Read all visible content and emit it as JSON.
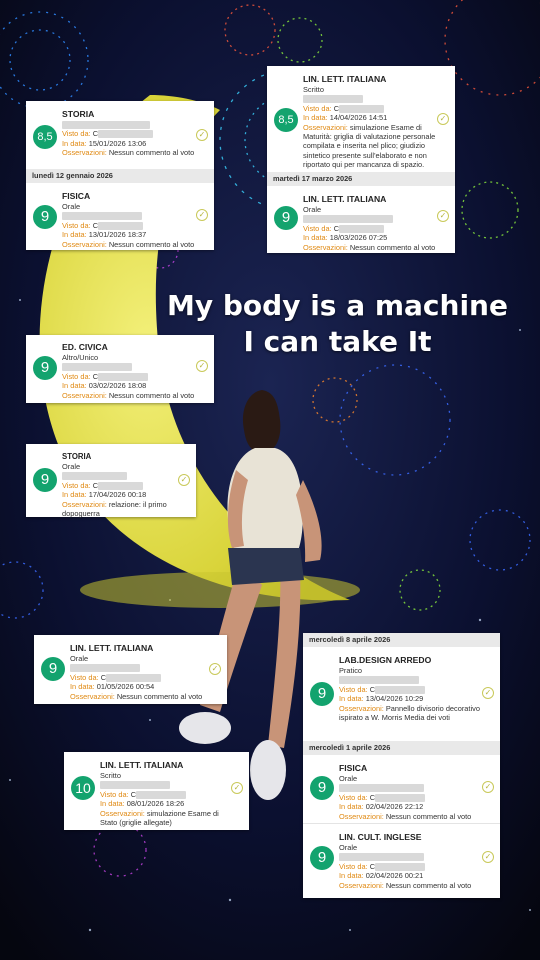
{
  "caption": {
    "line1": "My body is a machine",
    "line2": "I can take It"
  },
  "labels": {
    "visto": "Visto da:",
    "data": "In data:",
    "oss": "Osservazioni:"
  },
  "cards": [
    {
      "name": "storia-fisica",
      "entries": [
        {
          "subject": "STORIA",
          "type": "",
          "grade": "8,5",
          "visto": "C",
          "data": "15/01/2026 13:06",
          "oss": "Nessun commento al voto"
        },
        {
          "separator": "lunedì 12 gennaio 2026",
          "subject": "FISICA",
          "type": "Orale",
          "grade": "9",
          "visto": "C",
          "data": "13/01/2026 18:37",
          "oss": "Nessun commento al voto"
        }
      ]
    },
    {
      "name": "italiano-marzo",
      "entries": [
        {
          "subject": "LIN. LETT. ITALIANA",
          "type": "Scritto",
          "grade": "8,5",
          "visto": "C",
          "data": "14/04/2026 14:51",
          "oss": "simulazione Esame di Maturità: griglia di valutazione personale compilata e inserita nel plico; giudizio sintetico presente sull'elaborato e non riportato qui per mancanza di spazio."
        },
        {
          "separator": "martedì 17 marzo 2026",
          "subject": "LIN. LETT. ITALIANA",
          "type": "Orale",
          "grade": "9",
          "visto": "C",
          "data": "18/03/2026 07:25",
          "oss": "Nessun commento al voto"
        }
      ]
    },
    {
      "name": "ed-civica",
      "entries": [
        {
          "subject": "ED. CIVICA",
          "type": "Altro/Unico",
          "grade": "9",
          "visto": "C",
          "data": "03/02/2026 18:08",
          "oss": "Nessun commento al voto"
        }
      ]
    },
    {
      "name": "storia-orale",
      "entries": [
        {
          "subject": "STORIA",
          "type": "Orale",
          "grade": "9",
          "visto": "C",
          "data": "17/04/2026 00:18",
          "oss": "relazione: il primo dopoguerra"
        }
      ]
    },
    {
      "name": "italiano-orale",
      "entries": [
        {
          "subject": "LIN. LETT. ITALIANA",
          "type": "Orale",
          "grade": "9",
          "visto": "C",
          "data": "01/05/2026 00:54",
          "oss": "Nessun commento al voto"
        }
      ]
    },
    {
      "name": "italiano-scritto",
      "entries": [
        {
          "subject": "LIN. LETT. ITALIANA",
          "type": "Scritto",
          "grade": "10",
          "visto": "C",
          "data": "08/01/2026 18:26",
          "oss": "simulazione Esame di Stato (griglie allegate)"
        }
      ]
    },
    {
      "name": "aprile",
      "entries": [
        {
          "separator": "mercoledì 8 aprile 2026",
          "subject": "LAB.DESIGN ARREDO",
          "type": "Pratico",
          "grade": "9",
          "visto": "C",
          "data": "13/04/2026 10:29",
          "oss": "Pannello divisorio decorativo ispirato a W. Morris Media dei voti"
        },
        {
          "separator": "mercoledì 1 aprile 2026",
          "subject": "FISICA",
          "type": "Orale",
          "grade": "9",
          "visto": "C",
          "data": "02/04/2026 22:12",
          "oss": "Nessun commento al voto"
        },
        {
          "subject": "LIN. CULT. INGLESE",
          "type": "Orale",
          "grade": "9",
          "visto": "C",
          "data": "02/04/2026 00:21",
          "oss": "Nessun commento al voto"
        }
      ]
    }
  ]
}
